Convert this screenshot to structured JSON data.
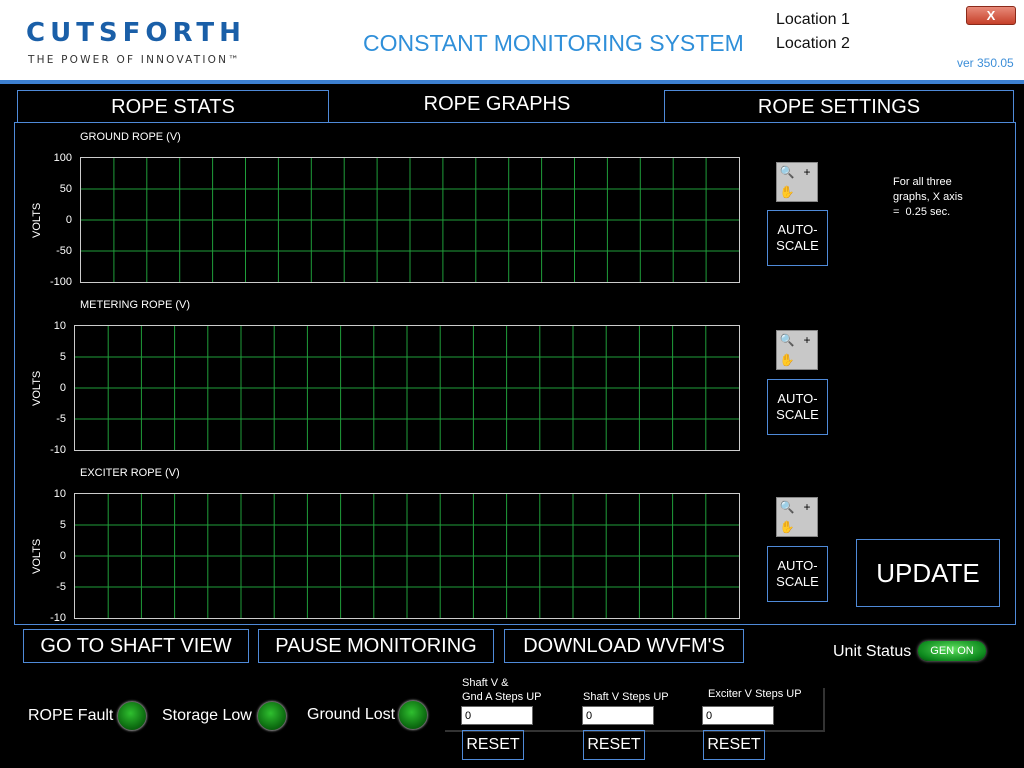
{
  "header": {
    "logo_main": "CUTSFORTH",
    "logo_tagline": "THE POWER OF INNOVATION™",
    "title": "CONSTANT MONITORING SYSTEM",
    "location1": "Location 1",
    "location2": "Location 2",
    "close_label": "X",
    "version": "ver 350.05"
  },
  "tabs": [
    {
      "label": "ROPE STATS"
    },
    {
      "label": "ROPE GRAPHS",
      "active": true
    },
    {
      "label": "ROPE SETTINGS"
    }
  ],
  "graphs": [
    {
      "title": "GROUND ROPE (V)",
      "ylabel": "VOLTS",
      "ticks": [
        "100",
        "50",
        "0",
        "-50",
        "-100"
      ],
      "ylim": [
        -100,
        100
      ]
    },
    {
      "title": "METERING ROPE (V)",
      "ylabel": "VOLTS",
      "ticks": [
        "10",
        "5",
        "0",
        "-5",
        "-10"
      ],
      "ylim": [
        -10,
        10
      ]
    },
    {
      "title": "EXCITER ROPE (V)",
      "ylabel": "VOLTS",
      "ticks": [
        "10",
        "5",
        "0",
        "-5",
        "-10"
      ],
      "ylim": [
        -10,
        10
      ]
    }
  ],
  "autoscale_label": "AUTO-SCALE",
  "autoscale_line1": "AUTO-",
  "autoscale_line2": "SCALE",
  "note": {
    "line1": "For all three",
    "line2": "graphs, X axis",
    "line3": "=  0.25 sec."
  },
  "update_label": "UPDATE",
  "bottom_buttons": {
    "shaft_view": "GO TO SHAFT VIEW",
    "pause": "PAUSE MONITORING",
    "download": "DOWNLOAD WVFM'S"
  },
  "unit_status": {
    "label": "Unit Status",
    "value": "GEN ON",
    "color": "#1faa2a"
  },
  "lamps": [
    {
      "label": "ROPE Fault"
    },
    {
      "label": "Storage Low"
    },
    {
      "label": "Ground Lost"
    }
  ],
  "steps": [
    {
      "label_line1": "Shaft V &",
      "label_line2": "Gnd A Steps UP",
      "value": "0",
      "reset": "RESET"
    },
    {
      "label_line1": "Shaft V Steps UP",
      "value": "0",
      "reset": "RESET"
    },
    {
      "label_line1": "Exciter V Steps UP",
      "value": "0",
      "reset": "RESET"
    }
  ],
  "colors": {
    "accent": "#4f8ad8",
    "grid": "#1f9e3a",
    "title": "#2f8fd9"
  }
}
